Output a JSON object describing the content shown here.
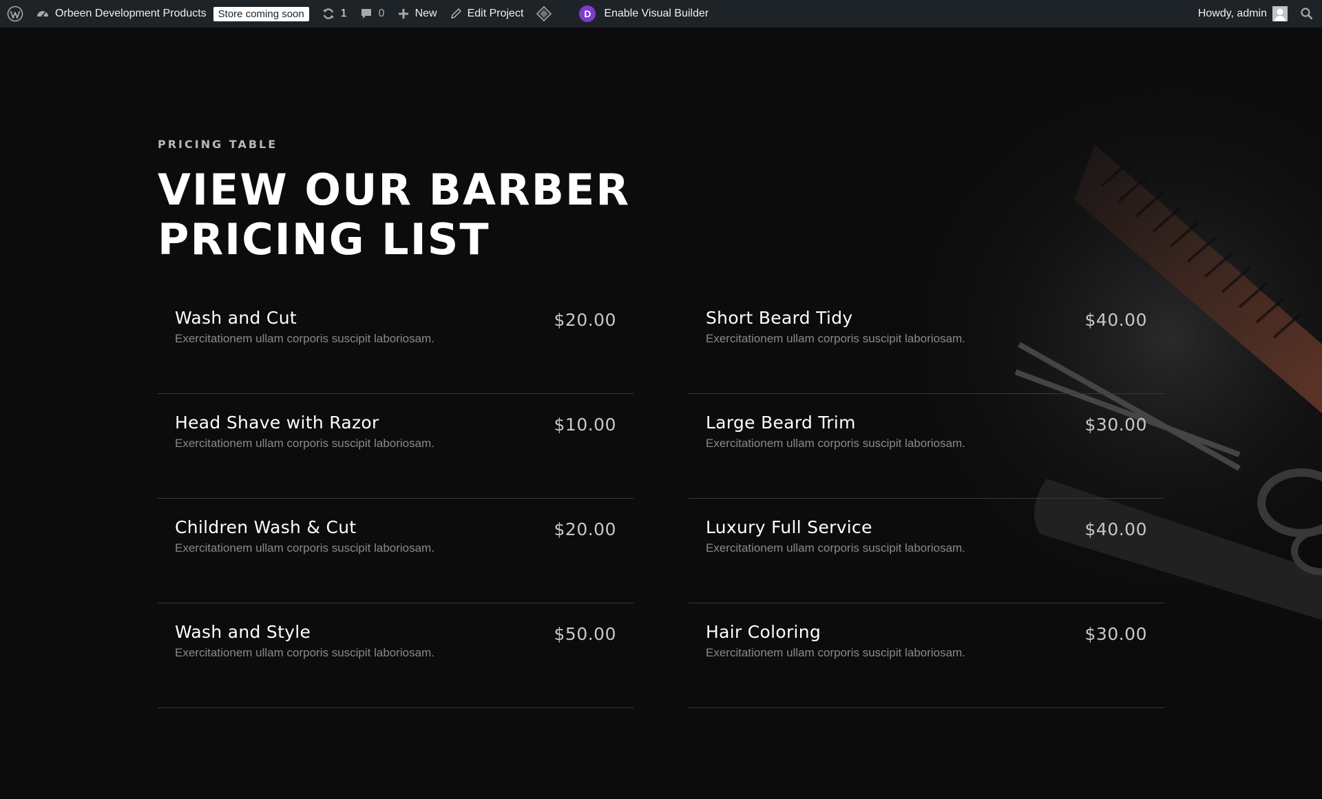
{
  "adminbar": {
    "site_name": "Orbeen Development Products",
    "store_badge": "Store coming soon",
    "updates_count": "1",
    "comments_count": "0",
    "new_label": "New",
    "edit_label": "Edit Project",
    "visual_builder_label": "Enable Visual Builder",
    "greeting": "Howdy, admin"
  },
  "section": {
    "eyebrow": "PRICING TABLE",
    "title_line1": "VIEW OUR BARBER",
    "title_line2": "PRICING LIST"
  },
  "pricing": {
    "left": [
      {
        "title": "Wash and Cut",
        "desc": "Exercitationem ullam corporis suscipit laboriosam.",
        "price": "$20.00"
      },
      {
        "title": "Head Shave with Razor",
        "desc": "Exercitationem ullam corporis suscipit laboriosam.",
        "price": "$10.00"
      },
      {
        "title": "Children Wash & Cut",
        "desc": "Exercitationem ullam corporis suscipit laboriosam.",
        "price": "$20.00"
      },
      {
        "title": "Wash and Style",
        "desc": "Exercitationem ullam corporis suscipit laboriosam.",
        "price": "$50.00"
      }
    ],
    "right": [
      {
        "title": "Short Beard Tidy",
        "desc": "Exercitationem ullam corporis suscipit laboriosam.",
        "price": "$40.00"
      },
      {
        "title": "Large Beard Trim",
        "desc": "Exercitationem ullam corporis suscipit laboriosam.",
        "price": "$30.00"
      },
      {
        "title": "Luxury Full Service",
        "desc": "Exercitationem ullam corporis suscipit laboriosam.",
        "price": "$40.00"
      },
      {
        "title": "Hair Coloring",
        "desc": "Exercitationem ullam corporis suscipit laboriosam.",
        "price": "$30.00"
      }
    ]
  },
  "colors": {
    "background": "#0c0c0d",
    "adminbar": "#1d2327",
    "divider": "#3a3a3c",
    "divi_purple": "#7e3bd0"
  },
  "icons": [
    "wordpress-logo-icon",
    "dashboard-icon",
    "updates-icon",
    "comments-icon",
    "plus-icon",
    "pencil-icon",
    "divi-diamond-icon",
    "divi-logo-icon",
    "avatar-icon",
    "search-icon",
    "scissors-icon",
    "comb-icon"
  ]
}
